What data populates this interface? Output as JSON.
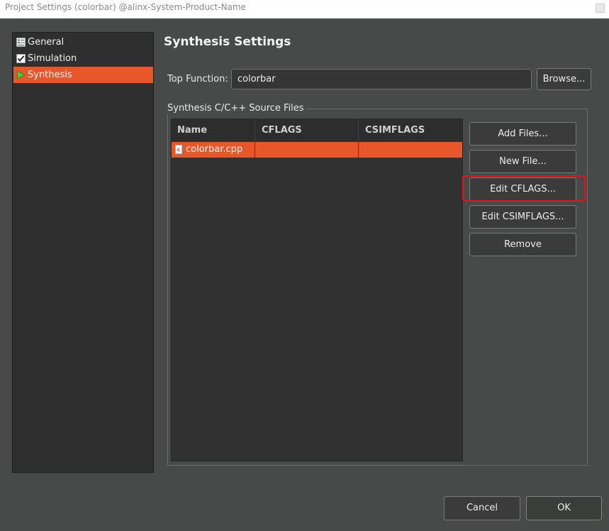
{
  "window": {
    "title": "Project Settings (colorbar) @alinx-System-Product-Name"
  },
  "sidebar": {
    "items": [
      {
        "label": "General",
        "icon": "general-settings-icon"
      },
      {
        "label": "Simulation",
        "icon": "checkbox-checked-icon"
      },
      {
        "label": "Synthesis",
        "icon": "play-arrow-icon",
        "selected": true
      }
    ]
  },
  "main": {
    "heading": "Synthesis Settings",
    "top_function": {
      "label": "Top Function:",
      "value": "colorbar",
      "browse_label": "Browse..."
    },
    "source_files": {
      "group_label": "Synthesis C/C++ Source Files",
      "columns": [
        "Name",
        "CFLAGS",
        "CSIMFLAGS"
      ],
      "rows": [
        {
          "name": "colorbar.cpp",
          "cflags": "",
          "csimflags": ""
        }
      ],
      "buttons": {
        "add_files": "Add Files...",
        "new_file": "New File...",
        "edit_cflags": "Edit CFLAGS...",
        "edit_csimflags": "Edit CSIMFLAGS...",
        "remove": "Remove"
      }
    }
  },
  "footer": {
    "cancel": "Cancel",
    "ok": "OK"
  },
  "colors": {
    "accent": "#e8572a",
    "highlight_box": "#e0151b"
  }
}
